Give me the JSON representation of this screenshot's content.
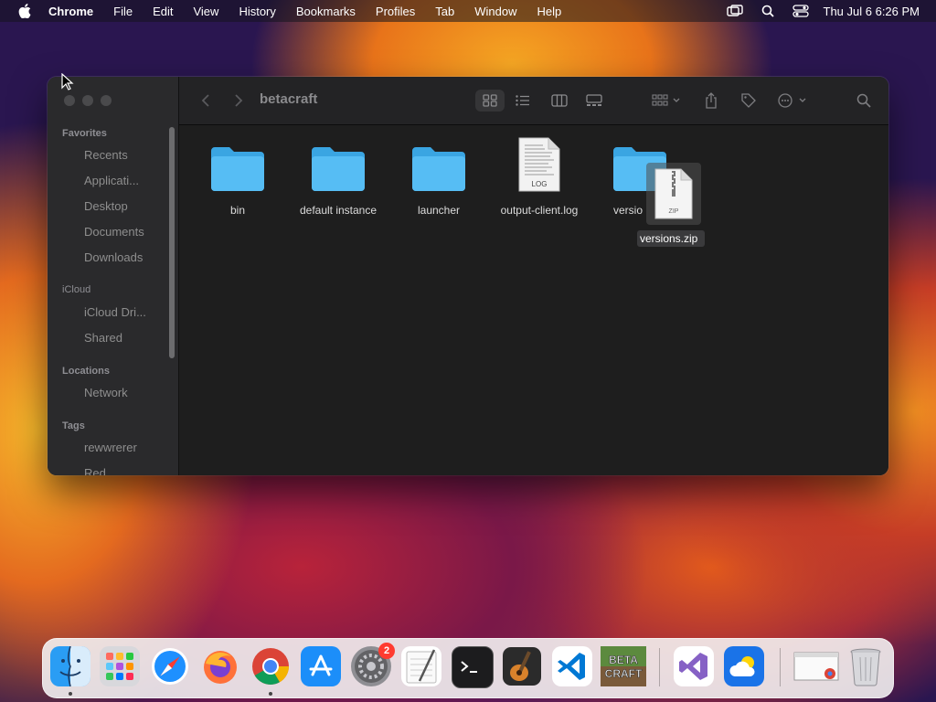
{
  "menubar": {
    "app_name": "Chrome",
    "items": [
      "File",
      "Edit",
      "View",
      "History",
      "Bookmarks",
      "Profiles",
      "Tab",
      "Window",
      "Help"
    ],
    "clock": "Thu Jul 6  6:26 PM"
  },
  "finder": {
    "title": "betacraft",
    "sidebar": {
      "favorites_heading": "Favorites",
      "favorites": [
        "Recents",
        "Applicati...",
        "Desktop",
        "Documents",
        "Downloads"
      ],
      "icloud_heading": "iCloud",
      "icloud": [
        "iCloud Dri...",
        "Shared"
      ],
      "locations_heading": "Locations",
      "locations": [
        "Network"
      ],
      "tags_heading": "Tags",
      "tags": [
        "rewwrerer",
        "Red"
      ]
    },
    "files": [
      {
        "name": "bin",
        "kind": "folder-icon"
      },
      {
        "name": "default instance",
        "kind": "folder-icon"
      },
      {
        "name": "launcher",
        "kind": "folder-icon"
      },
      {
        "name": "output-client.log",
        "kind": "log-file-icon"
      },
      {
        "name": "versio",
        "kind": "folder-icon"
      }
    ],
    "log_icon_label": "LOG",
    "dragging": {
      "name": "versions.zip",
      "icon_label": "ZIP"
    }
  },
  "dock": {
    "settings_badge": "2",
    "beta_line1": "BETA",
    "beta_line2": "CRAFT"
  },
  "colors": {
    "folder_blue": "#4fb6f0",
    "window_bg": "#1e1e1e",
    "sidebar_bg": "#2a2a2c"
  }
}
